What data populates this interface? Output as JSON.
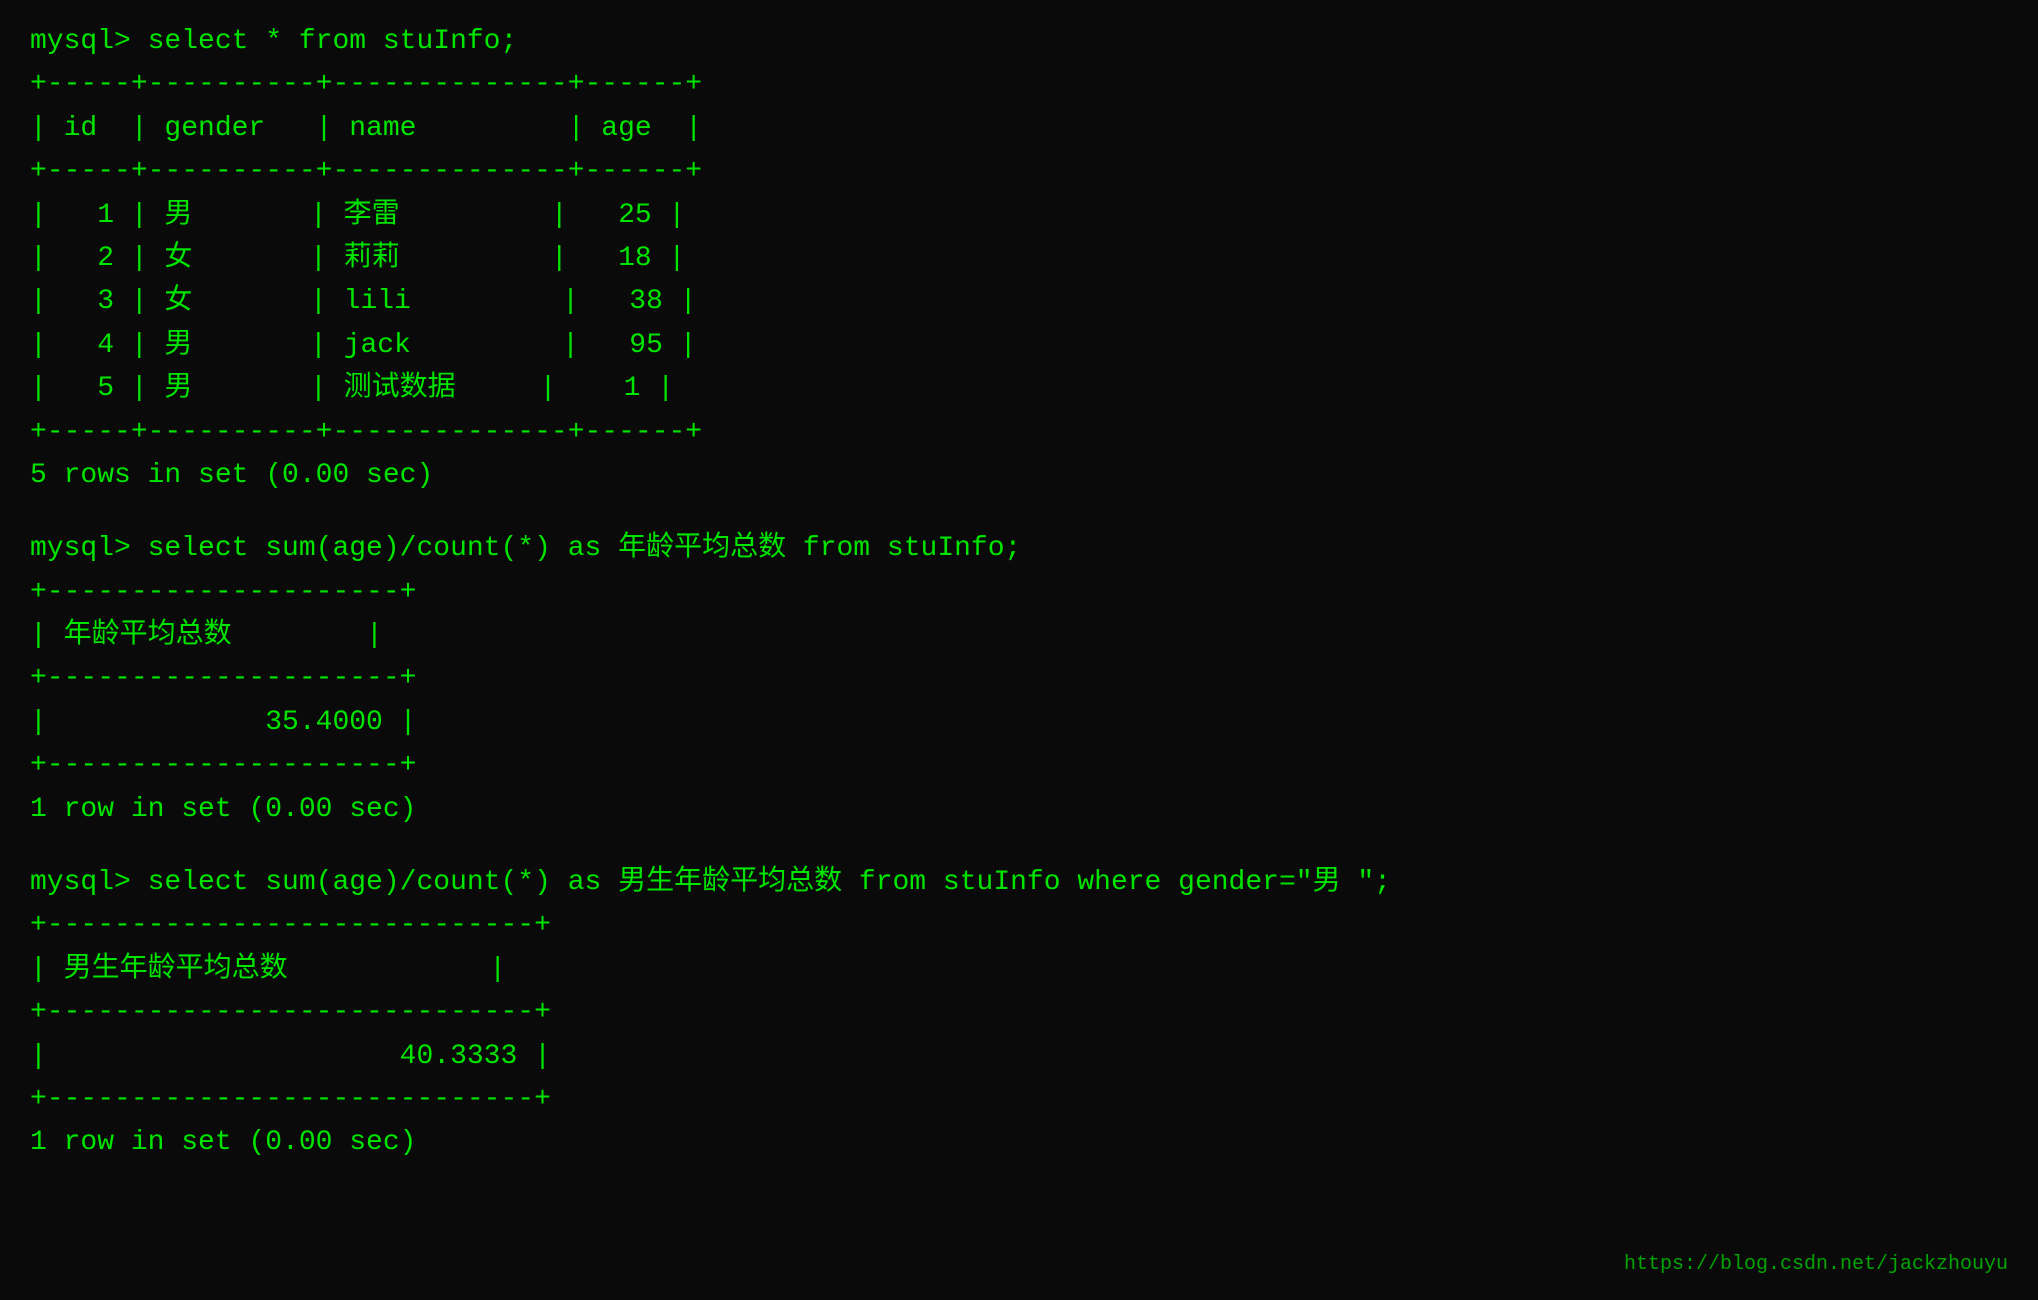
{
  "terminal": {
    "block1": {
      "prompt": "mysql> select * from stuInfo;",
      "separator1": "+-----+----------+--------------+------+",
      "header": "| id  | gender   | name         | age  |",
      "separator2": "+-----+----------+--------------+------+",
      "rows": [
        "|   1 | 男       | 李雷         |   25 |",
        "|   2 | 女       | 莉莉         |   18 |",
        "|   3 | 女       | lili         |   38 |",
        "|   4 | 男       | jack         |   95 |",
        "|   5 | 男       | 测试数据     |    1 |"
      ],
      "separator3": "+-----+----------+--------------+------+",
      "result": "5 rows in set (0.00 sec)"
    },
    "block2": {
      "prompt": "mysql> select sum(age)/count(*) as 年龄平均总数 from stuInfo;",
      "separator1": "+---------------------+",
      "header": "| 年龄平均总数        |",
      "separator2": "+---------------------+",
      "rows": [
        "|             35.4000 |"
      ],
      "separator3": "+---------------------+",
      "result": "1 row in set (0.00 sec)"
    },
    "block3": {
      "prompt": "mysql> select sum(age)/count(*) as 男生年龄平均总数 from stuInfo where gender=\"男 \";",
      "separator1": "+-----------------------------+",
      "header": "| 男生年龄平均总数            |",
      "separator2": "+-----------------------------+",
      "rows": [
        "|                     40.3333 |"
      ],
      "separator3": "+-----------------------------+",
      "result": "1 row in set (0.00 sec)"
    }
  },
  "watermark": {
    "text": "https://blog.csdn.net/jackzhouyu"
  }
}
